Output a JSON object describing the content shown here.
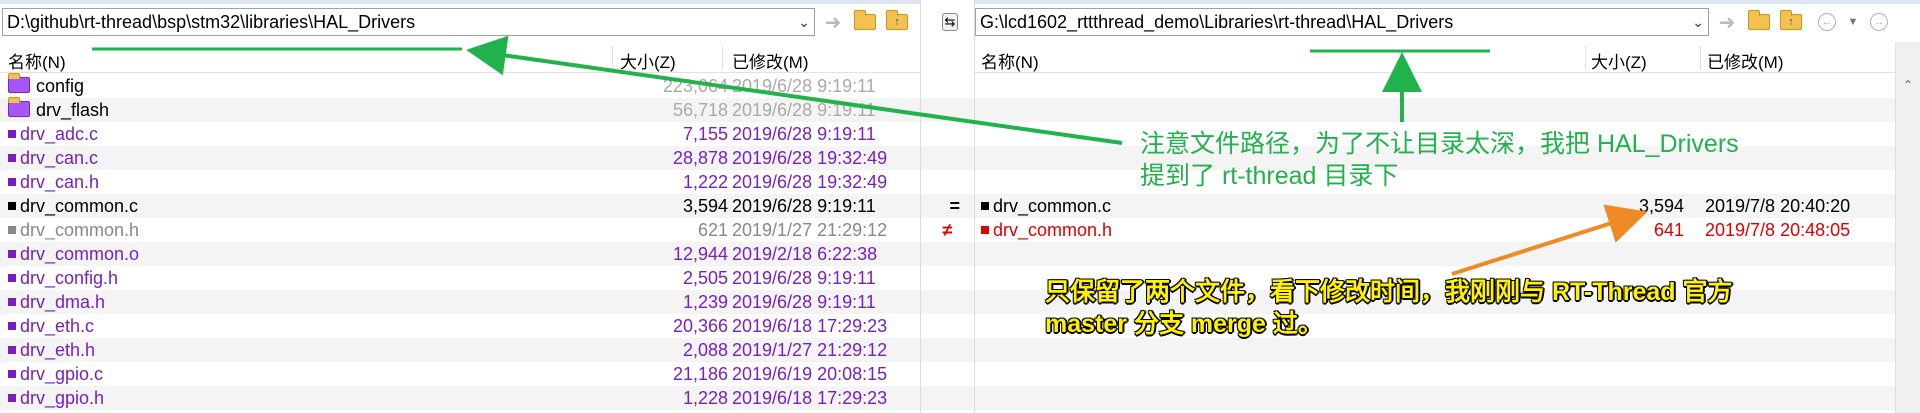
{
  "left": {
    "path": "D:\\github\\rt-thread\\bsp\\stm32\\libraries\\HAL_Drivers",
    "headers": {
      "name": "名称(N)",
      "size": "大小(Z)",
      "modified": "已修改(M)"
    },
    "rows": [
      {
        "name": "config",
        "size": "223,064",
        "date": "2019/6/28 9:19:11",
        "type": "folder",
        "color": "#aaaaaa"
      },
      {
        "name": "drv_flash",
        "size": "56,718",
        "date": "2019/6/28 9:19:11",
        "type": "folder",
        "color": "#aaaaaa"
      },
      {
        "name": "drv_adc.c",
        "size": "7,155",
        "date": "2019/6/28 9:19:11",
        "type": "file",
        "color": "#7a1fbf"
      },
      {
        "name": "drv_can.c",
        "size": "28,878",
        "date": "2019/6/28 19:32:49",
        "type": "file",
        "color": "#7a1fbf"
      },
      {
        "name": "drv_can.h",
        "size": "1,222",
        "date": "2019/6/28 19:32:49",
        "type": "file",
        "color": "#7a1fbf"
      },
      {
        "name": "drv_common.c",
        "size": "3,594",
        "date": "2019/6/28 9:19:11",
        "type": "file",
        "color": "#000000"
      },
      {
        "name": "drv_common.h",
        "size": "621",
        "date": "2019/1/27 21:29:12",
        "type": "file",
        "color": "#888888"
      },
      {
        "name": "drv_common.o",
        "size": "12,944",
        "date": "2019/2/18 6:22:38",
        "type": "file",
        "color": "#7a1fbf"
      },
      {
        "name": "drv_config.h",
        "size": "2,505",
        "date": "2019/6/28 9:19:11",
        "type": "file",
        "color": "#7a1fbf"
      },
      {
        "name": "drv_dma.h",
        "size": "1,239",
        "date": "2019/6/28 9:19:11",
        "type": "file",
        "color": "#7a1fbf"
      },
      {
        "name": "drv_eth.c",
        "size": "20,366",
        "date": "2019/6/18 17:29:23",
        "type": "file",
        "color": "#7a1fbf"
      },
      {
        "name": "drv_eth.h",
        "size": "2,088",
        "date": "2019/1/27 21:29:12",
        "type": "file",
        "color": "#7a1fbf"
      },
      {
        "name": "drv_gpio.c",
        "size": "21,186",
        "date": "2019/6/19 20:08:15",
        "type": "file",
        "color": "#7a1fbf"
      },
      {
        "name": "drv_gpio.h",
        "size": "1,228",
        "date": "2019/6/18 17:29:23",
        "type": "file",
        "color": "#7a1fbf"
      }
    ]
  },
  "gutter": {
    "marks": [
      "",
      "",
      "",
      "",
      "",
      "=",
      "≠",
      "",
      "",
      "",
      "",
      "",
      "",
      ""
    ],
    "mark_colors": [
      "",
      "",
      "",
      "",
      "",
      "#000000",
      "#e00000",
      "",
      "",
      "",
      "",
      "",
      "",
      ""
    ]
  },
  "right": {
    "path": "G:\\lcd1602_rttthread_demo\\Libraries\\rt-thread\\HAL_Drivers",
    "headers": {
      "name": "名称(N)",
      "size": "大小(Z)",
      "modified": "已修改(M)"
    },
    "rows": [
      {
        "name": "",
        "size": "",
        "date": "",
        "color": "#000000",
        "type": "empty"
      },
      {
        "name": "",
        "size": "",
        "date": "",
        "color": "#000000",
        "type": "empty"
      },
      {
        "name": "",
        "size": "",
        "date": "",
        "color": "#000000",
        "type": "empty"
      },
      {
        "name": "",
        "size": "",
        "date": "",
        "color": "#000000",
        "type": "empty"
      },
      {
        "name": "",
        "size": "",
        "date": "",
        "color": "#000000",
        "type": "empty"
      },
      {
        "name": "drv_common.c",
        "size": "3,594",
        "date": "2019/7/8 20:40:20",
        "color": "#000000",
        "type": "file"
      },
      {
        "name": "drv_common.h",
        "size": "641",
        "date": "2019/7/8 20:48:05",
        "color": "#e00000",
        "type": "file"
      },
      {
        "name": "",
        "size": "",
        "date": "",
        "color": "#000000",
        "type": "empty"
      },
      {
        "name": "",
        "size": "",
        "date": "",
        "color": "#000000",
        "type": "empty"
      },
      {
        "name": "",
        "size": "",
        "date": "",
        "color": "#000000",
        "type": "empty"
      },
      {
        "name": "",
        "size": "",
        "date": "",
        "color": "#000000",
        "type": "empty"
      },
      {
        "name": "",
        "size": "",
        "date": "",
        "color": "#000000",
        "type": "empty"
      },
      {
        "name": "",
        "size": "",
        "date": "",
        "color": "#000000",
        "type": "empty"
      },
      {
        "name": "",
        "size": "",
        "date": "",
        "color": "#000000",
        "type": "empty"
      }
    ]
  },
  "annotations": {
    "green_line1": "注意文件路径，为了不让目录太深，我把 HAL_Drivers",
    "green_line2": "提到了 rt-thread 目录下",
    "yellow_line1": "只保留了两个文件，看下修改时间，我刚刚与 RT-Thread 官方",
    "yellow_line2": "master 分支 merge 过。",
    "green_color": "#22b24c",
    "orange_color": "#f08a24",
    "yellow_color": "#fff200"
  },
  "icons": {
    "left_toolbar": [
      "go-arrow-icon",
      "folder-open-icon",
      "folder-up-icon"
    ],
    "sync_button": "swap-icon",
    "right_toolbar": [
      "go-arrow-icon",
      "folder-open-icon",
      "folder-up-icon",
      "back-icon",
      "dropdown-icon",
      "forward-icon"
    ]
  }
}
